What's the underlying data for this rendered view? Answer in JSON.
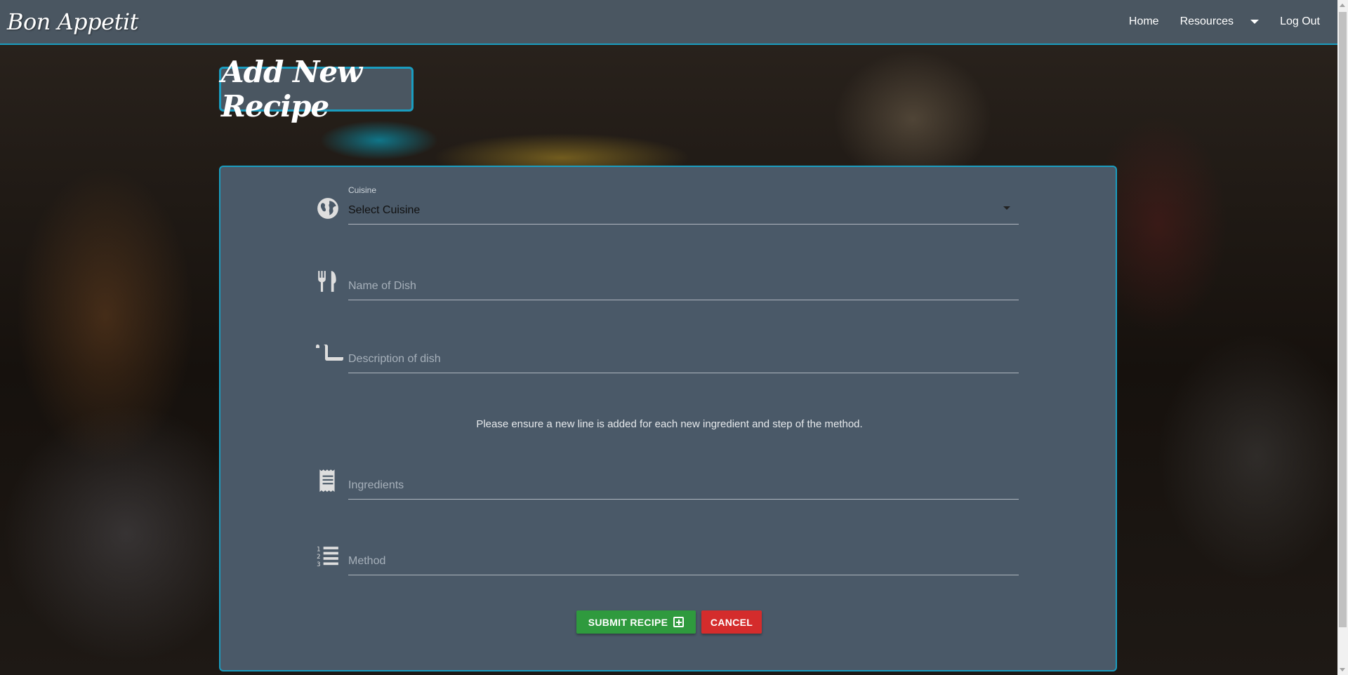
{
  "navbar": {
    "brand": "Bon Appetit",
    "links": {
      "home": "Home",
      "resources": "Resources",
      "logout": "Log Out"
    }
  },
  "page": {
    "heading": "Add New Recipe"
  },
  "form": {
    "cuisine": {
      "label": "Cuisine",
      "value": "Select Cuisine",
      "icon": "globe-icon"
    },
    "dish_name": {
      "placeholder": "Name of Dish",
      "icon": "utensils-icon"
    },
    "description": {
      "placeholder": "Description of dish",
      "icon": "scroll-icon"
    },
    "note": "Please ensure a new line is added for each new ingredient and step of the method.",
    "ingredients": {
      "placeholder": "Ingredients",
      "icon": "receipt-icon"
    },
    "method": {
      "placeholder": "Method",
      "icon": "numbered-list-icon"
    },
    "submit_label": "SUBMIT RECIPE",
    "cancel_label": "CANCEL"
  },
  "colors": {
    "navbar": "#4a5661",
    "accent": "#1a9dc0",
    "card": "#4a5968",
    "submit": "#2f9a3e",
    "cancel": "#d42c2c"
  }
}
